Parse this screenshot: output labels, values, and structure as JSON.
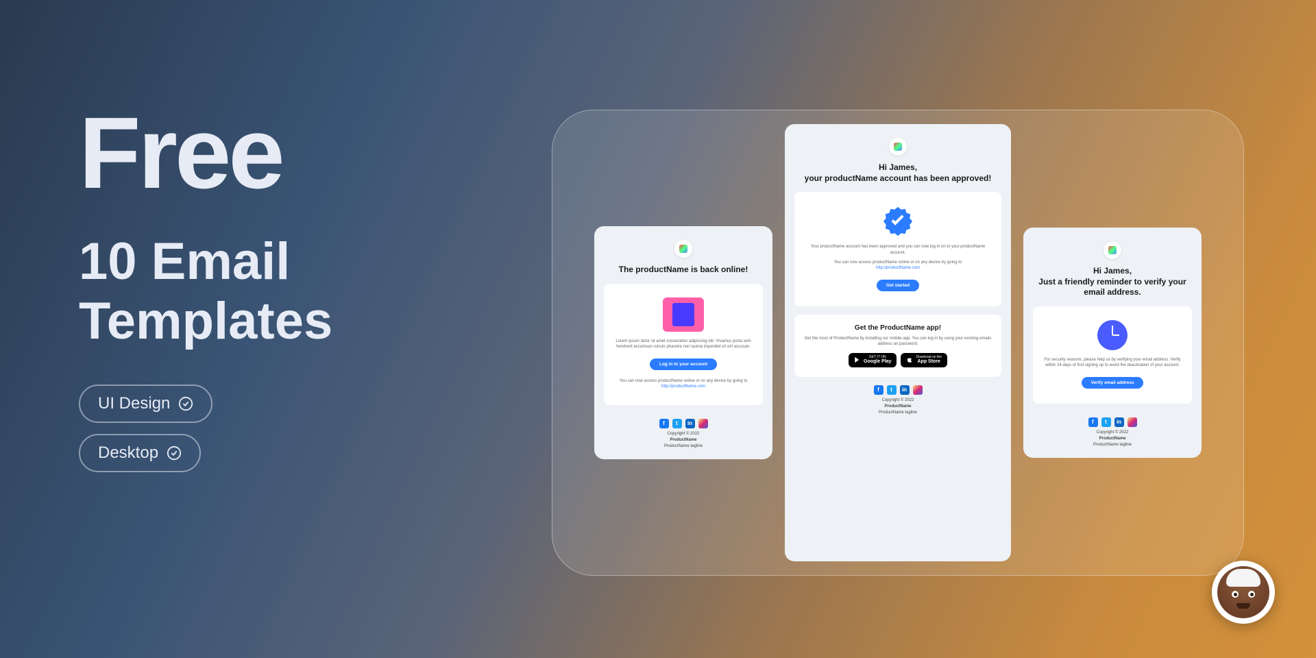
{
  "hero": {
    "title": "Free",
    "subtitle_line1": "10 Email",
    "subtitle_line2": "Templates"
  },
  "tags": [
    {
      "label": "UI Design"
    },
    {
      "label": "Desktop"
    }
  ],
  "cards": {
    "left": {
      "heading": "The productName is back online!",
      "body": "Lorem ipsum dolor sit amet consectetur adipiscing elit. Vivamus porta sem hendrerit accumsan rutrum pharetra non lacinia imperdiet sit orit accusan.",
      "button": "Log in to your account",
      "linktext": "You can now access productName online or on any device by going to",
      "link": "http://productName.com"
    },
    "center": {
      "heading_prefix": "Hi ",
      "heading_name": "James",
      "heading_suffix": ",",
      "heading_line2": "your productName account has been approved!",
      "body1": "Your productName account has been approved and you can now log in on to your productName account.",
      "body2": "You can now access productName online or on any device by going to",
      "link": "http://productName.com",
      "button": "Get started",
      "app_title": "Get the ProductName app!",
      "app_body": "Get the most of ProductName by installing our mobile app. You can log in by using your existing emails address an password.",
      "store_google_top": "GET IT ON",
      "store_google": "Google Play",
      "store_apple_top": "Download on the",
      "store_apple": "App Store"
    },
    "right": {
      "heading_prefix": "Hi ",
      "heading_name": "James",
      "heading_suffix": ",",
      "heading_line2": "Just a friendly reminder to verify your email address.",
      "body": "For security reasons, please help us by verifying your email address. Verify within 24 days of first signing up to avoid the deactivation of your account.",
      "button": "Verify email address"
    }
  },
  "footer": {
    "copyright": "Copyright © 2022",
    "product": "ProductName",
    "tagline": "ProductName tagline"
  }
}
